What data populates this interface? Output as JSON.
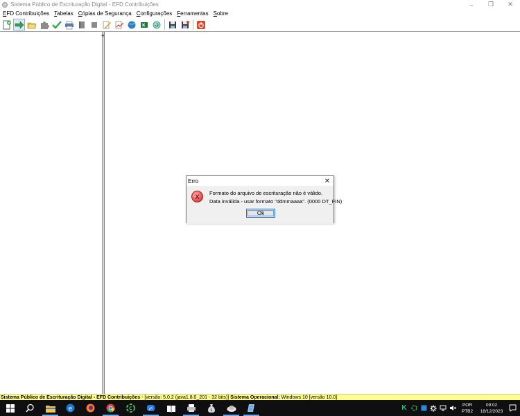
{
  "window": {
    "title": "Sistema Público de Escrituração Digital - EFD Contribuições",
    "controls": [
      "–",
      "❐",
      "✕"
    ]
  },
  "menu": {
    "items": [
      {
        "underline": "E",
        "rest": "FD Contribuições"
      },
      {
        "underline": "T",
        "rest": "abelas"
      },
      {
        "underline": "C",
        "rest": "ópias de Segurança"
      },
      {
        "underline": "C",
        "rest": "onfigurações"
      },
      {
        "underline": "F",
        "rest": "erramentas"
      },
      {
        "underline": "S",
        "rest": "obre"
      }
    ]
  },
  "toolbar": {
    "icons": [
      "new-document-icon",
      "import-arrow-icon",
      "open-folder-icon",
      "puzzle-icon",
      "validate-check-icon",
      "print-icon",
      "book-icon",
      "stop-icon",
      "edit-document-icon",
      "signature-icon",
      "web-globe-icon",
      "excel-icon",
      "refresh-icon",
      "save-icon",
      "save-as-icon",
      "exit-icon"
    ]
  },
  "dialog": {
    "title": "Erro",
    "message_line1": "Formato do arquivo de escrituração não é válido.",
    "message_line2": "Data inválida - usar formato \"ddmmaaaa\". (0000 DT_FIN)",
    "ok_label": "Ok",
    "icon": "error-icon",
    "icon_glyph": "X"
  },
  "statusbar": {
    "app_label": "Sistema Público de Escrituração Digital - EFD Contribuições",
    "version_text": " - [versão: 5.0.2 (java1.8.0_201 - 32 bits)] ",
    "os_label": "Sistema Operacional:",
    "os_value": " Windows 10 [versão 10.0]",
    "background": "#fffd8a"
  },
  "taskbar": {
    "apps": [
      "windows-start-icon",
      "search-icon",
      "file-explorer-icon",
      "edge-icon",
      "firefox-icon",
      "chrome-icon",
      "app-green-icon",
      "teams-icon",
      "reader-icon",
      "printer-icon",
      "money-bag-icon",
      "sped-icon",
      "notes-icon"
    ],
    "language": "POR",
    "keyboard": "PTB2",
    "time": "09:02",
    "date": "18/12/2023"
  }
}
